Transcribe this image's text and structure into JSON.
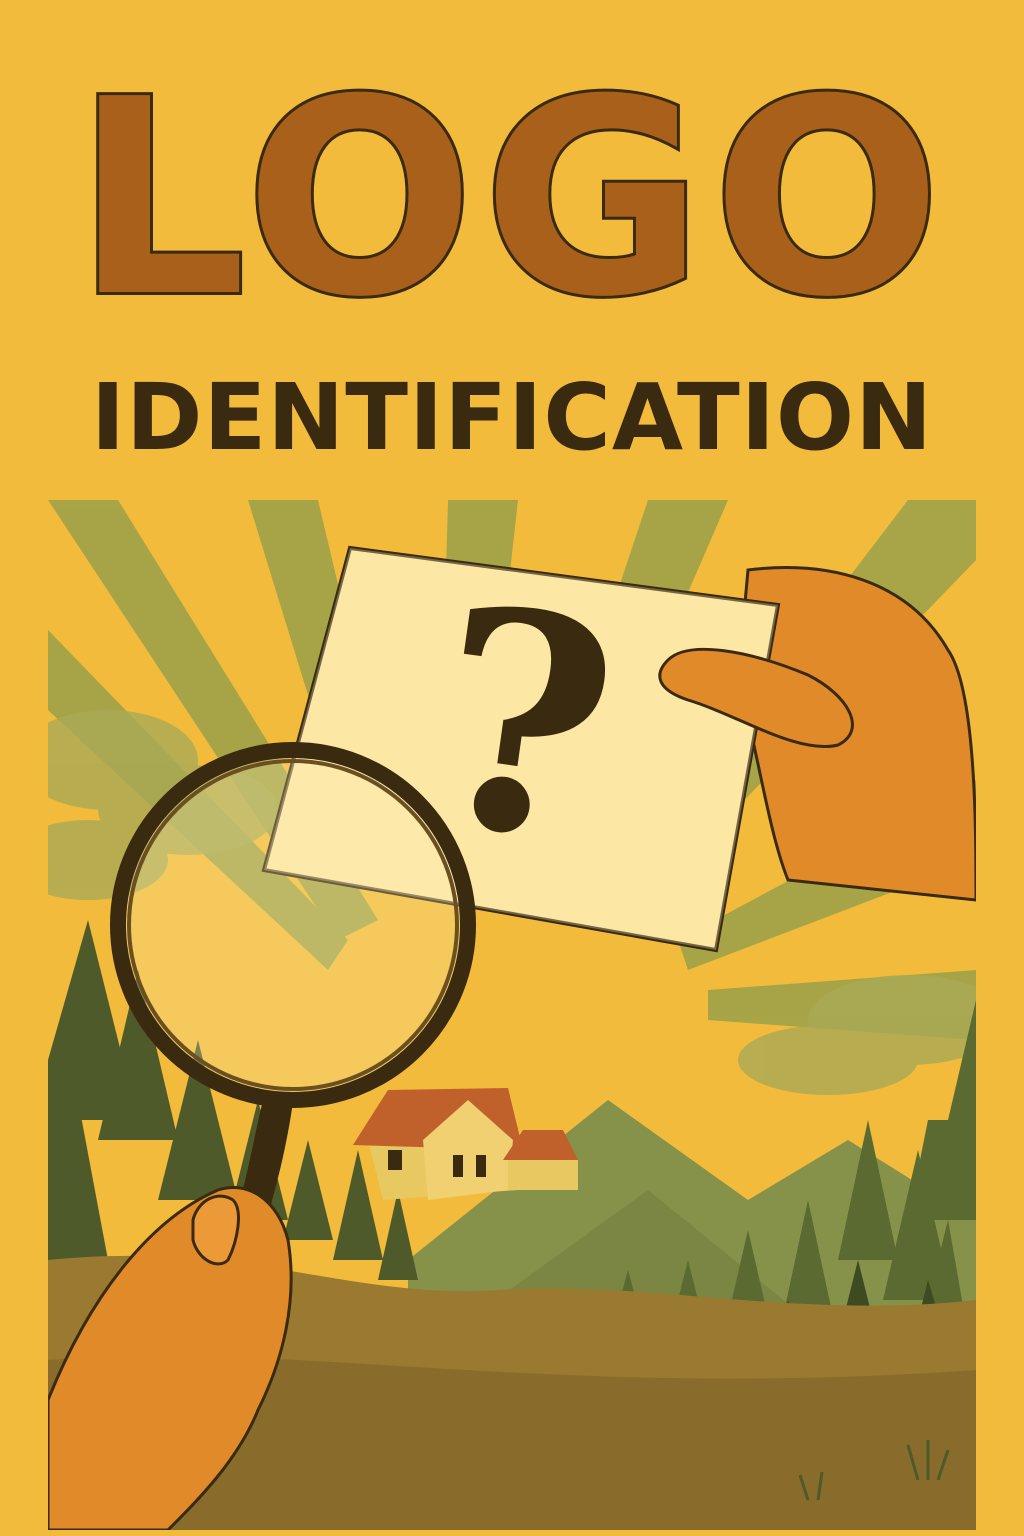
{
  "poster": {
    "title": "LOGO",
    "subtitle": "IDENTIFICATION",
    "card_symbol": "?"
  },
  "colors": {
    "background": "#f3bb3c",
    "title_fill": "#a9601a",
    "ink": "#3a2a10",
    "ray": "#9aa04a",
    "card": "#fbe29a",
    "skin": "#e08a2a",
    "forest": "#4e5a2a",
    "mountain": "#86914a",
    "roof": "#c0602a"
  }
}
